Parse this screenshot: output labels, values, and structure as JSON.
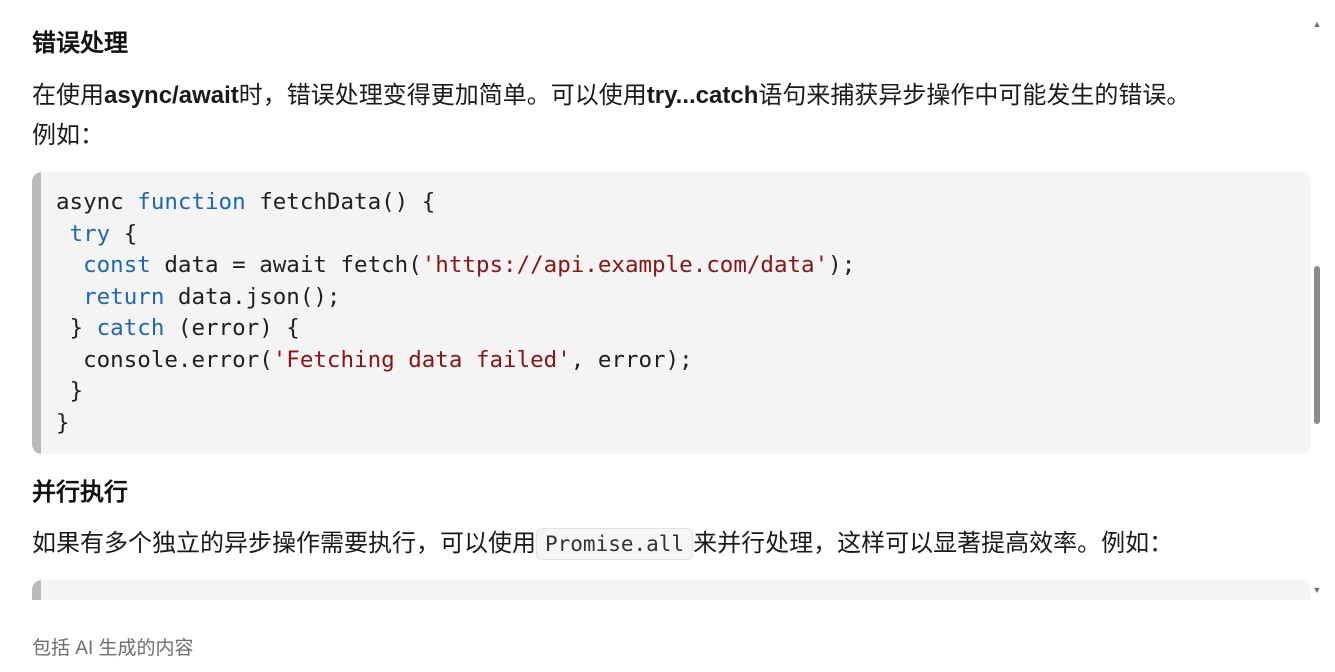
{
  "sections": {
    "error_handling": {
      "heading": "错误处理",
      "para_part1": "在使用",
      "para_bold1": "async/await",
      "para_part2": "时，错误处理变得更加简单。可以使用",
      "para_bold2": "try...catch",
      "para_part3": "语句来捕获异步操作中可能发生的错误。",
      "para_line2": "例如："
    },
    "parallel": {
      "heading": "并行执行",
      "para_part1": "如果有多个独立的异步操作需要执行，可以使用",
      "inline_code": "Promise.all",
      "para_part2": "来并行处理，这样可以显著提高效率。例如："
    }
  },
  "code_block_1": {
    "lines": [
      [
        {
          "t": "async "
        },
        {
          "t": "function",
          "c": "kw"
        },
        {
          "t": " fetchData() {"
        }
      ],
      [
        {
          "t": " "
        },
        {
          "t": "try",
          "c": "kw"
        },
        {
          "t": " {"
        }
      ],
      [
        {
          "t": "  "
        },
        {
          "t": "const",
          "c": "kw"
        },
        {
          "t": " data = await fetch("
        },
        {
          "t": "'https://api.example.com/data'",
          "c": "str"
        },
        {
          "t": ");"
        }
      ],
      [
        {
          "t": "  "
        },
        {
          "t": "return",
          "c": "kw"
        },
        {
          "t": " data.json();"
        }
      ],
      [
        {
          "t": " } "
        },
        {
          "t": "catch",
          "c": "kw"
        },
        {
          "t": " (error) {"
        }
      ],
      [
        {
          "t": "  console.error("
        },
        {
          "t": "'Fetching data failed'",
          "c": "str"
        },
        {
          "t": ", error);"
        }
      ],
      [
        {
          "t": " }"
        }
      ],
      [
        {
          "t": "}"
        }
      ]
    ]
  },
  "footer": {
    "disclaimer": "包括 AI 生成的内容"
  },
  "scrollbar": {
    "up_arrow": "▲",
    "down_arrow": "▼",
    "position_fraction": 0.45
  },
  "colors": {
    "keyword": "#1e68b3",
    "string": "#8a1414",
    "code_background": "#f4f4f4",
    "code_bar": "#b9b9b9"
  }
}
